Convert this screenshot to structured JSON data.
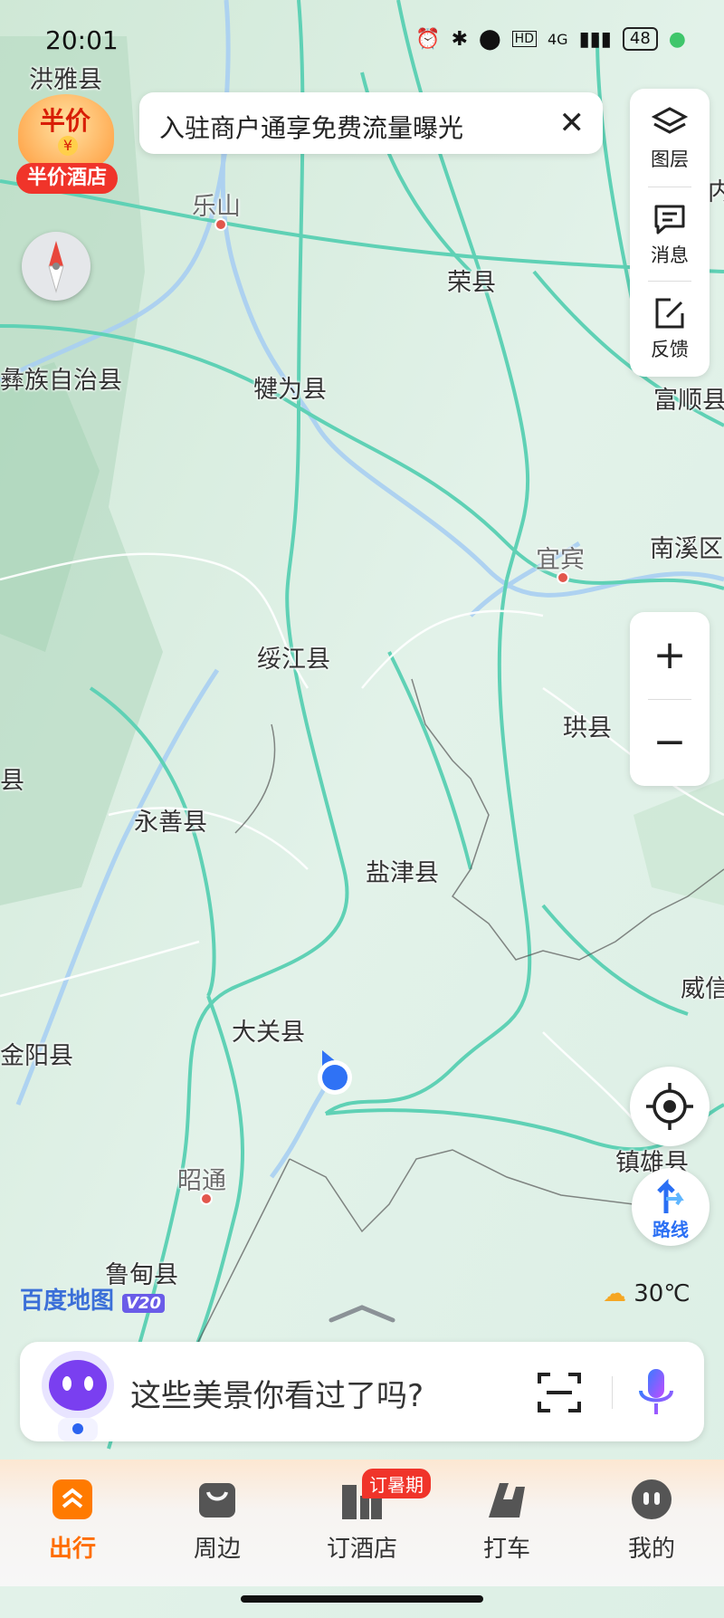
{
  "status_bar": {
    "time": "20:01",
    "network": "4G",
    "hd": "HD",
    "battery": "48"
  },
  "promo": {
    "badge_text": "半价",
    "label": "半价酒店",
    "coin": "¥"
  },
  "banner": {
    "text": "入驻商户通享免费流量曝光",
    "close": "✕"
  },
  "tools": [
    {
      "label": "图层"
    },
    {
      "label": "消息"
    },
    {
      "label": "反馈"
    }
  ],
  "zoom": {
    "in": "+",
    "out": "−"
  },
  "route": {
    "label": "路线"
  },
  "weather": {
    "temperature": "30℃"
  },
  "logo": {
    "name": "百度地图",
    "version": "V20"
  },
  "search": {
    "placeholder": "这些美景你看过了吗?"
  },
  "tabs": [
    {
      "label": "出行",
      "active": true
    },
    {
      "label": "周边"
    },
    {
      "label": "订酒店",
      "badge": "订暑期"
    },
    {
      "label": "打车"
    },
    {
      "label": "我的"
    }
  ],
  "map_labels": {
    "hongya": "洪雅县",
    "leshan": "乐山",
    "rongxian": "荣县",
    "fushun": "富顺县",
    "neijiang_partial": "内",
    "yizu": "彝族自治县",
    "qianwei": "犍为县",
    "yibin": "宜宾",
    "nanxi": "南溪区",
    "suijiang": "绥江县",
    "gongxian": "珙县",
    "yongshan": "永善县",
    "left_xian": "县",
    "yanjin": "盐津县",
    "weixin": "威信",
    "daguan": "大关县",
    "jinyang": "金阳县",
    "zhaotong": "昭通",
    "zhenxiong": "镇雄县",
    "ludian": "鲁甸县"
  }
}
